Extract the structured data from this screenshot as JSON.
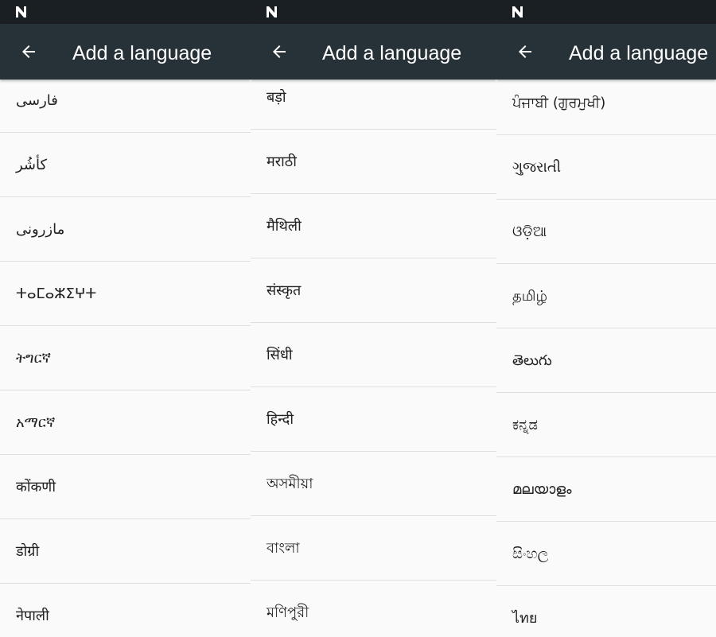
{
  "panels": [
    {
      "title": "Add a language",
      "languages": [
        "فارسی",
        "کأشُر",
        "مازرونی",
        "ⵜⴰⵎⴰⵣⵉⵖⵜ",
        "ትግርኛ",
        "አማርኛ",
        "कोंकणी",
        "डोग्री",
        "नेपाली"
      ]
    },
    {
      "title": "Add a language",
      "languages": [
        "बड़ो",
        "मराठी",
        "मैथिली",
        "संस्कृत",
        "सिंधी",
        "हिन्दी",
        "অসমীয়া",
        "বাংলা",
        "মণিপুরী"
      ]
    },
    {
      "title": "Add a language",
      "languages": [
        "ਪੰਜਾਬੀ (ਗੁਰਮੁਖੀ)",
        "ગુજરાતી",
        "ଓଡ଼ିଆ",
        "தமிழ்",
        "తెలుగు",
        "ಕನ್ನಡ",
        "മലയാളം",
        "සිංහල",
        "ไทย"
      ]
    }
  ],
  "icons": {
    "status_logo": "n-logo-icon",
    "back": "arrow-back-icon"
  },
  "colors": {
    "status_bar": "#1a1f23",
    "app_bar": "#263238",
    "list_background": "#fafafa",
    "divider": "#dedede",
    "text": "#212121"
  }
}
